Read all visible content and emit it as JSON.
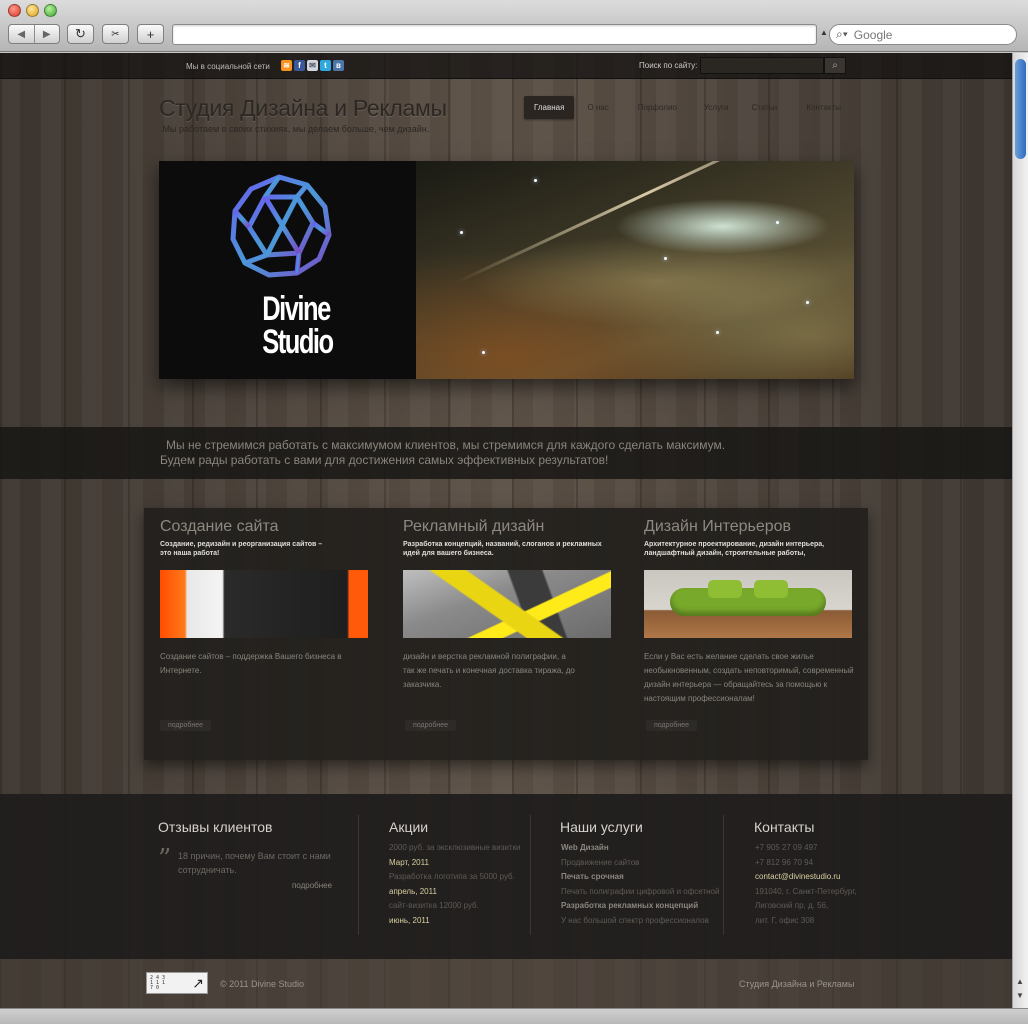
{
  "browser": {
    "search_placeholder": "Google"
  },
  "topbar": {
    "social_label": "Мы в социальной сети",
    "social_icons": [
      "rss-icon",
      "facebook-icon",
      "mail-icon",
      "twitter-icon",
      "vkontakte-icon"
    ],
    "search_label": "Поиск по сайту:"
  },
  "header": {
    "title": "Студия Дизайна и Рекламы",
    "tagline": ".Мы работаем в своих стихиях,  мы делаем больше, чем дизайн.",
    "nav": [
      "Главная",
      "О нас",
      "Порфолио",
      "Услуги",
      "Статьи",
      "Контакты"
    ],
    "active_nav": "Главная"
  },
  "hero": {
    "logo_line1": "Divine",
    "logo_line2": "Studio"
  },
  "band": {
    "line1": "Мы не стремимся работать с максимумом клиентов, мы стремимся для каждого сделать максимум.",
    "line2": "Будем рады работать с вами для достижения самых эффективных результатов!"
  },
  "services": [
    {
      "title": "Создание сайта",
      "subtitle": "Создание, редизайн и реорганизация сайтов – это наша работа!",
      "description": "Создание сайтов – поддержка Вашего бизнеса в Интернете.",
      "more": "подробнее"
    },
    {
      "title": "Рекламный дизайн",
      "subtitle": "Разработка концепций, названий, слоганов и рекламных идей для вашего бизнеса.",
      "description": "дизайн и верстка рекламной полиграфии, а так же печать и конечная доставка тиража, до заказчика.",
      "more": "подробнее"
    },
    {
      "title": "Дизайн Интерьеров",
      "subtitle": "Архитектурное проектирование, дизайн интерьера, ландшафтный дизайн, строительные работы,",
      "description": "Если у Вас есть желание сделать свое жилье необыкновенным, создать неповторимый, современный дизайн интерьера — обращайтесь за помощью к настоящим профессионалам!",
      "more": "подробнее"
    }
  ],
  "footer": {
    "reviews": {
      "title": "Отзывы клиентов",
      "text": "18 причин, почему Вам стоит с нами сотрудничать.",
      "more": "подробнее"
    },
    "promos": {
      "title": "Акции",
      "items": [
        {
          "text": "2000 руб. за эксклюзивные визитки",
          "date": "Март, 2011"
        },
        {
          "text": "Разработка логотипа за 5000 руб.",
          "date": "апрель, 2011"
        },
        {
          "text": "сайт-визитка 12000 руб.",
          "date": "июнь, 2011"
        }
      ]
    },
    "services": {
      "title": "Наши услуги",
      "items": [
        {
          "name": "Web Дизайн",
          "desc": "Продвижение сайтов"
        },
        {
          "name": "Печать срочная",
          "desc": "Печать полиграфии цифровой и офсетной"
        },
        {
          "name": "Разработка рекламных концепций",
          "desc": "У нас большой спектр профессионалов"
        }
      ]
    },
    "contacts": {
      "title": "Контакты",
      "phone1": "+7 905 27 09 497",
      "phone2": "+7 812 96 70 94",
      "email": "contact@divinestudio.ru",
      "address1": "191040, г. Санкт-Петербург,",
      "address2": "Лиговский пр, д. 56,",
      "address3": "лит. Г, офис 308"
    }
  },
  "bottom": {
    "badge_lines": [
      "2 4 3",
      "1 1 1",
      "7 0"
    ],
    "copyright": "© 2011 Divine Studio",
    "brand": "Студия Дизайна и Рекламы"
  },
  "colors": {
    "accent_contact": "#d8cfa0",
    "panel": "#221f1c"
  }
}
